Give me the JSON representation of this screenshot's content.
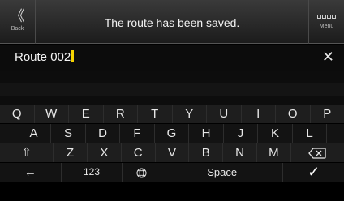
{
  "header": {
    "back_label": "Back",
    "back_glyph": "《",
    "title": "The route has been saved.",
    "menu_label": "Menu"
  },
  "input": {
    "value": "Route 002",
    "clear_glyph": "✕"
  },
  "keyboard": {
    "row1": [
      "Q",
      "W",
      "E",
      "R",
      "T",
      "Y",
      "U",
      "I",
      "O",
      "P"
    ],
    "row2": [
      "A",
      "S",
      "D",
      "F",
      "G",
      "H",
      "J",
      "K",
      "L"
    ],
    "row3": [
      "Z",
      "X",
      "C",
      "V",
      "B",
      "N",
      "M"
    ],
    "shift_glyph": "⇧",
    "back_arrow_glyph": "←",
    "numbers_label": "123",
    "space_label": "Space",
    "done_glyph": "✓"
  },
  "icons": {
    "back": "double-chevron-left-icon",
    "menu": "grid-dots-icon",
    "clear": "close-icon",
    "shift": "shift-icon",
    "delete": "backspace-icon",
    "language": "globe-icon",
    "done": "checkmark-icon"
  }
}
